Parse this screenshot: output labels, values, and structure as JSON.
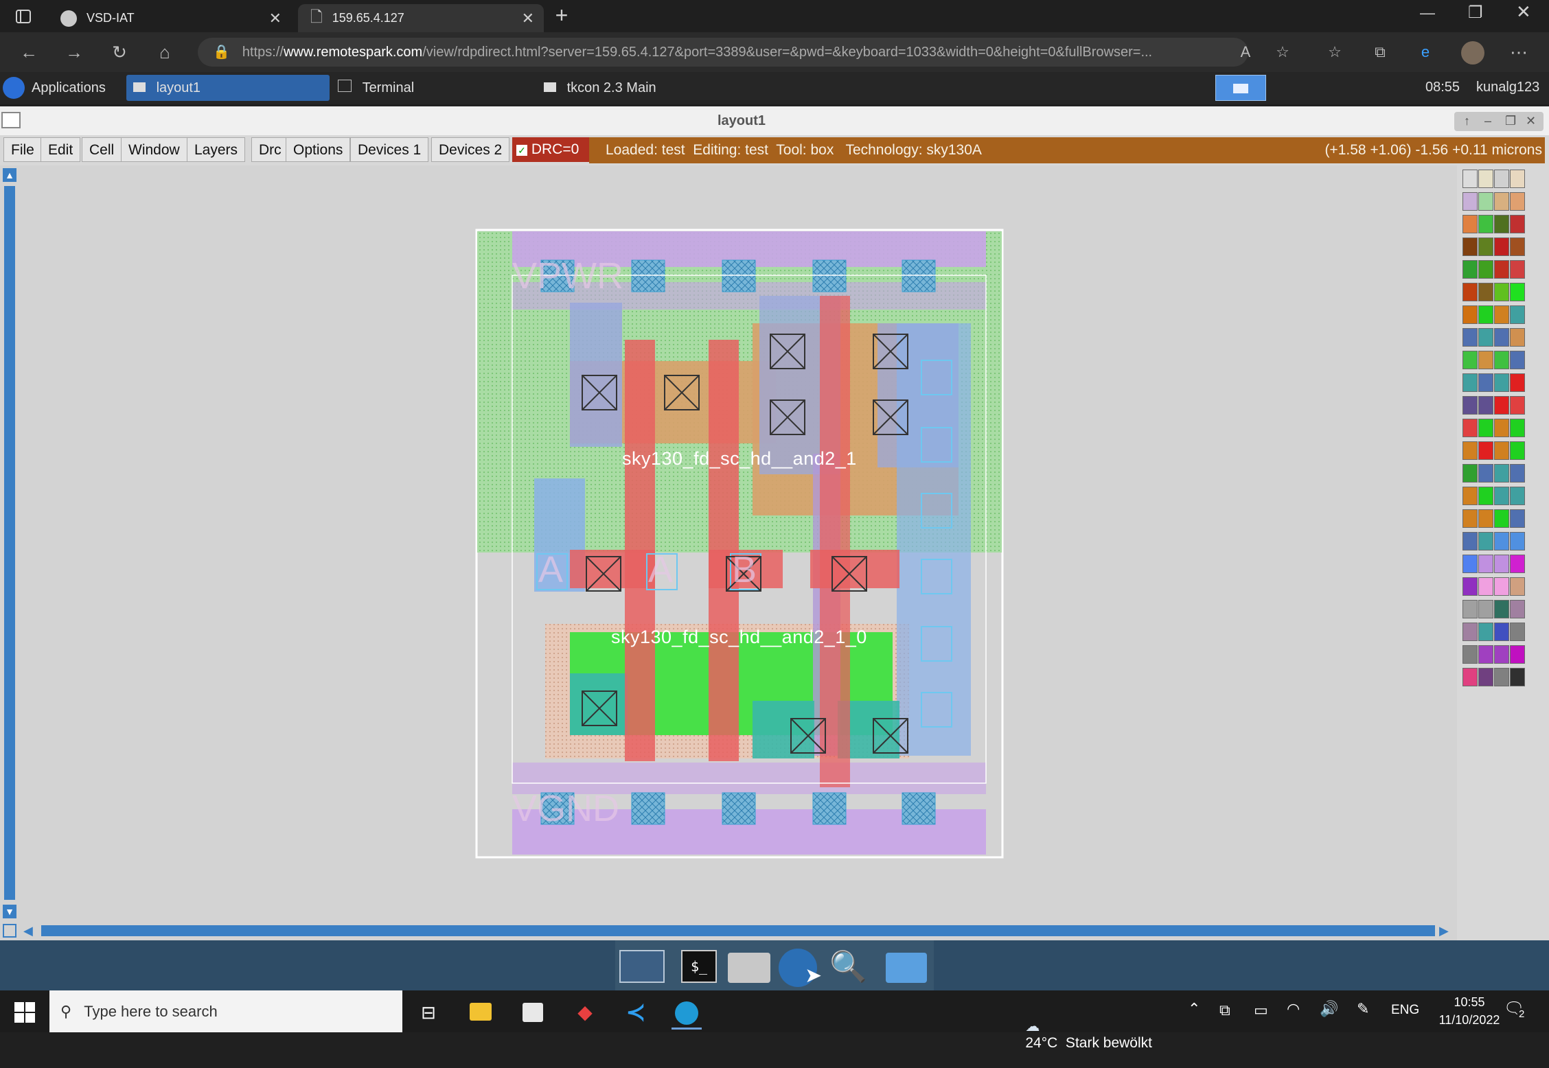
{
  "browser": {
    "tabs": [
      {
        "title": "VSD-IAT",
        "active": false
      },
      {
        "title": "159.65.4.127",
        "active": true
      }
    ],
    "url_prefix": "https://",
    "url_host": "www.remotespark.com",
    "url_rest": "/view/rdpdirect.html?server=159.65.4.127&port=3389&user=&pwd=&keyboard=1033&width=0&height=0&fullBrowser=..."
  },
  "remote_panel": {
    "applications_label": "Applications",
    "tasks": [
      "layout1",
      "Terminal",
      "tkcon 2.3 Main"
    ],
    "time": "08:55",
    "user": "kunalg123"
  },
  "magic_window": {
    "title": "layout1",
    "menus": [
      "File",
      "Edit",
      "Cell",
      "Window",
      "Layers",
      "Drc",
      "Options",
      "Devices 1",
      "Devices 2"
    ],
    "drc_label": "DRC=0",
    "status": "Loaded: test  Editing: test  Tool: box   Technology: sky130A",
    "coords": "(+1.58 +1.06) -1.56 +0.11 microns",
    "cell_labels": [
      "sky130_fd_sc_hd__and2_1",
      "sky130_fd_sc_hd__and2_1_0"
    ],
    "port_labels": [
      "A",
      "A",
      "B"
    ],
    "rail_labels": [
      "VPWR",
      "VGND"
    ]
  },
  "palette": {
    "colors": [
      "#dcdcdc",
      "#e6e0c8",
      "#d0d0d0",
      "#e8d8c0",
      "#c8b0d8",
      "#9fd89f",
      "#d8b080",
      "#e0a070",
      "#e08040",
      "#40c040",
      "#507020",
      "#c03030",
      "#804010",
      "#608020",
      "#c02020",
      "#a05020",
      "#30a030",
      "#40a020",
      "#c03020",
      "#d04040",
      "#c04010",
      "#806020",
      "#60c020",
      "#20e020",
      "#d07010",
      "#20d020",
      "#d08020",
      "#40a0a0",
      "#5070b0",
      "#40a0a0",
      "#5070b0",
      "#d09050",
      "#40c040",
      "#d09040",
      "#40c040",
      "#5070b0",
      "#40a0a0",
      "#5070b0",
      "#40a0a0",
      "#e02020",
      "#605090",
      "#605090",
      "#e02020",
      "#e04040",
      "#e04040",
      "#20d020",
      "#d08020",
      "#20d020",
      "#d08020",
      "#e02020",
      "#d08020",
      "#20d020",
      "#30a030",
      "#5070b0",
      "#40a0a0",
      "#5070b0",
      "#d08020",
      "#20d020",
      "#40a0a0",
      "#40a0a0",
      "#d08020",
      "#d08020",
      "#20d020",
      "#5070b0",
      "#5070b0",
      "#40a0a0",
      "#5090e0",
      "#5090e0",
      "#5080f0",
      "#c090e0",
      "#c090e0",
      "#d020d0",
      "#9030c0",
      "#f0a0e0",
      "#f0a0e0",
      "#d0a080",
      "#a0a0a0",
      "#a0a0a0",
      "#307060",
      "#a080a0",
      "#a080a0",
      "#40a0a0",
      "#4050c0",
      "#808080",
      "#808080",
      "#a040c0",
      "#a040c0",
      "#c010c0",
      "#e04080",
      "#704080",
      "#808080",
      "#303030"
    ]
  },
  "taskbar": {
    "search_placeholder": "Type here to search",
    "weather": "24°C  Stark bewölkt",
    "lang": "ENG",
    "time": "10:55",
    "date": "11/10/2022",
    "notifications": "2"
  }
}
